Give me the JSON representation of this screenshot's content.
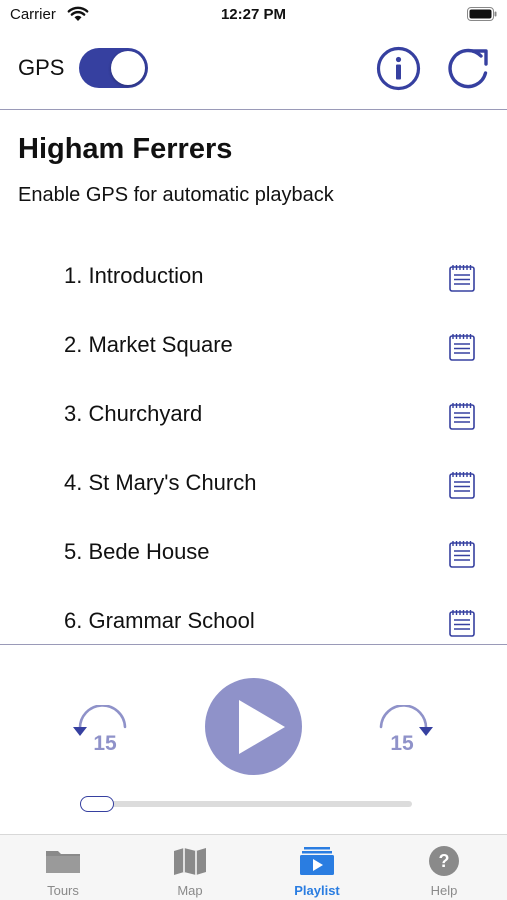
{
  "status_bar": {
    "carrier": "Carrier",
    "time": "12:27 PM"
  },
  "header": {
    "gps_label": "GPS",
    "gps_enabled": true,
    "toggle_color": "#3640a0"
  },
  "tour": {
    "title": "Higham Ferrers",
    "subtitle": "Enable GPS for automatic playback"
  },
  "playlist": {
    "tracks": [
      {
        "label": "1. Introduction"
      },
      {
        "label": "2. Market Square"
      },
      {
        "label": "3. Churchyard"
      },
      {
        "label": "4. St Mary's Church"
      },
      {
        "label": "5. Bede House"
      },
      {
        "label": "6. Grammar School"
      }
    ]
  },
  "player": {
    "skip_back_label": "15",
    "skip_forward_label": "15",
    "progress": 0,
    "play_color": "#8f92c9"
  },
  "tabs": [
    {
      "label": "Tours",
      "icon": "folder-icon",
      "active": false
    },
    {
      "label": "Map",
      "icon": "map-icon",
      "active": false
    },
    {
      "label": "Playlist",
      "icon": "playlist-icon",
      "active": true
    },
    {
      "label": "Help",
      "icon": "help-icon",
      "active": false
    }
  ],
  "colors": {
    "accent": "#3640a0",
    "active_tab": "#2a7de1",
    "divider": "#9a9ab8"
  }
}
